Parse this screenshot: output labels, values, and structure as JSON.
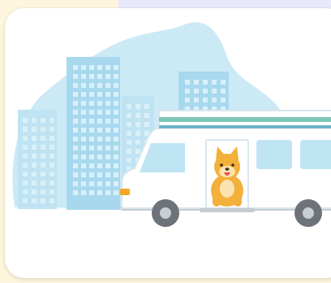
{
  "scene": {
    "subject": "dog-in-van",
    "colors": {
      "background": "#fdf6dd",
      "top_strip": "#e9e9fb",
      "card": "#ffffff",
      "sky_blob": "#cbeaf6",
      "building_light": "#bfe3f2",
      "building_mid": "#a8d8ee",
      "window": "#d9f0f9",
      "van_body": "#ffffff",
      "van_outline": "#d8e6ee",
      "van_stripe_green": "#7fc8b5",
      "van_stripe_blue": "#6fb4c8",
      "van_window": "#bfe5f5",
      "wheel": "#6d7378",
      "hubcap": "#c9ced2",
      "road": "#c4ccd2",
      "dog_fur": "#f3b03a",
      "dog_light": "#fbe3b0",
      "tongue": "#e8534a",
      "headlight": "#f5a623"
    }
  }
}
